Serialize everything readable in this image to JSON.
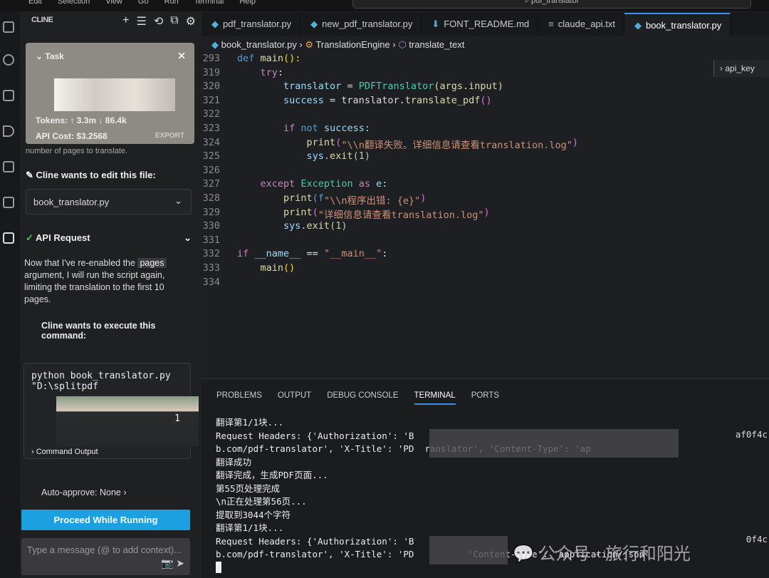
{
  "window": {
    "menu": [
      "Edit",
      "Selection",
      "View",
      "Go",
      "Run",
      "Terminal",
      "Help"
    ],
    "search": "pdf_translator"
  },
  "sidebar": {
    "title": "CLINE",
    "tools": [
      "+",
      "☰",
      "⟲",
      "⧉",
      "⚙"
    ],
    "task": {
      "label": "Task",
      "tokens": "Tokens: ↑ 3.3m ↓ 86.4k",
      "cost": "API Cost: $3.2568",
      "export": "EXPORT"
    },
    "cut_text": "number of pages to translate.",
    "edit_label": "Cline wants to edit this file:",
    "edit_file": "book_translator.py",
    "api_request": "API Request",
    "message_pre": "Now that I've re-enabled the ",
    "message_code": "pages",
    "message_post": " argument, I will run the script again, limiting the translation to the first 10 pages.",
    "exec_label": "Cline wants to execute this command:",
    "command_lines": [
      "python book_translator.py",
      "\"D:\\splitpdf"
    ],
    "command_trailing": "1",
    "command_output": "Command Output",
    "auto_approve": "Auto-approve: None",
    "proceed": "Proceed While Running",
    "chat_placeholder": "Type a message (@ to add context)..."
  },
  "editor": {
    "tabs": [
      {
        "label": "pdf_translator.py",
        "icon": "python"
      },
      {
        "label": "new_pdf_translator.py",
        "icon": "python"
      },
      {
        "label": "FONT_README.md",
        "icon": "markdown"
      },
      {
        "label": "claude_api.txt",
        "icon": "text"
      },
      {
        "label": "book_translator.py",
        "icon": "python",
        "active": true
      }
    ],
    "breadcrumb": [
      "book_translator.py",
      "TranslationEngine",
      "translate_text"
    ],
    "sticky_outline": "api_key",
    "lines": [
      {
        "n": "293",
        "t": [
          [
            "def ",
            "#569cd6"
          ],
          [
            "main",
            "#dcdcaa"
          ],
          [
            "():",
            "#ffd700"
          ]
        ]
      },
      {
        "n": "319",
        "t": [
          [
            "    "
          ],
          [
            "try",
            "#c586c0"
          ],
          [
            ":",
            "#ddd"
          ]
        ]
      },
      {
        "n": "320",
        "t": [
          [
            "        translator ",
            "#9cdcfe"
          ],
          [
            "= ",
            "#ddd"
          ],
          [
            "PDFTranslator",
            "#4ec9b0"
          ],
          [
            "(args.input)",
            "#dcdcaa"
          ]
        ]
      },
      {
        "n": "321",
        "t": [
          [
            "        success ",
            "#9cdcfe"
          ],
          [
            "= translator.",
            "#ddd"
          ],
          [
            "translate_pdf",
            "#dcdcaa"
          ],
          [
            "()",
            "#da70d6"
          ]
        ]
      },
      {
        "n": "322",
        "t": []
      },
      {
        "n": "323",
        "t": [
          [
            "        "
          ],
          [
            "if ",
            "#c586c0"
          ],
          [
            "not ",
            "#569cd6"
          ],
          [
            "success:",
            "#9cdcfe"
          ]
        ]
      },
      {
        "n": "324",
        "t": [
          [
            "            "
          ],
          [
            "print",
            "#dcdcaa"
          ],
          [
            "(",
            "#da70d6"
          ],
          [
            "\"\\\\n翻译失败。详细信息请查看translation.log\"",
            "#ce9178"
          ],
          [
            ")",
            "#da70d6"
          ]
        ]
      },
      {
        "n": "325",
        "t": [
          [
            "            sys.",
            "#9cdcfe"
          ],
          [
            "exit",
            "#dcdcaa"
          ],
          [
            "(1)",
            "#b5cea8"
          ]
        ]
      },
      {
        "n": "326",
        "t": []
      },
      {
        "n": "327",
        "t": [
          [
            "    "
          ],
          [
            "except ",
            "#c586c0"
          ],
          [
            "Exception ",
            "#4ec9b0"
          ],
          [
            "as ",
            "#c586c0"
          ],
          [
            "e:",
            "#9cdcfe"
          ]
        ]
      },
      {
        "n": "328",
        "t": [
          [
            "        "
          ],
          [
            "print",
            "#dcdcaa"
          ],
          [
            "(f",
            "#569cd6"
          ],
          [
            "\"\\\\n程序出错: {e}\"",
            "#ce9178"
          ],
          [
            ")",
            "#da70d6"
          ]
        ]
      },
      {
        "n": "329",
        "t": [
          [
            "        "
          ],
          [
            "print",
            "#dcdcaa"
          ],
          [
            "(",
            "#da70d6"
          ],
          [
            "\"详细信息请查看translation.log\"",
            "#ce9178"
          ],
          [
            ")",
            "#da70d6"
          ]
        ]
      },
      {
        "n": "330",
        "t": [
          [
            "        sys.",
            "#9cdcfe"
          ],
          [
            "exit",
            "#dcdcaa"
          ],
          [
            "(1)",
            "#b5cea8"
          ]
        ]
      },
      {
        "n": "331",
        "t": []
      },
      {
        "n": "332",
        "t": [
          [
            "if ",
            "#c586c0"
          ],
          [
            "__name__ ",
            "#9cdcfe"
          ],
          [
            "== ",
            "#ddd"
          ],
          [
            "\"__main__\"",
            "#ce9178"
          ],
          [
            ":",
            "#ddd"
          ]
        ]
      },
      {
        "n": "333",
        "t": [
          [
            "    "
          ],
          [
            "main",
            "#dcdcaa"
          ],
          [
            "()",
            "#ffd700"
          ]
        ]
      },
      {
        "n": "334",
        "t": []
      }
    ]
  },
  "panel": {
    "tabs": [
      "PROBLEMS",
      "OUTPUT",
      "DEBUG CONSOLE",
      "TERMINAL",
      "PORTS"
    ],
    "active_tab": "TERMINAL",
    "terminal": [
      "翻译第1/1块...",
      "Request Headers: {'Authorization': 'B",
      "b.com/pdf-translator', 'X-Title': 'PD  ranslator', 'Content-Type': 'ap",
      "翻译成功",
      "翻译完成，生成PDF页面...",
      "第55页处理完成",
      "\\n正在处理第56页...",
      "提取到3044个字符",
      "翻译第1/1块...",
      "Request Headers: {'Authorization': 'B",
      "b.com/pdf-translator', 'X-Title': 'PD          'Content-Type': 'application/json'"
    ],
    "trailing_fragments": [
      "af0f4c",
      "0f4c"
    ]
  },
  "watermark": "公众号 · 旅行和阳光",
  "colors": {
    "accent": "#3b8eea",
    "button": "#1ba1e2"
  }
}
